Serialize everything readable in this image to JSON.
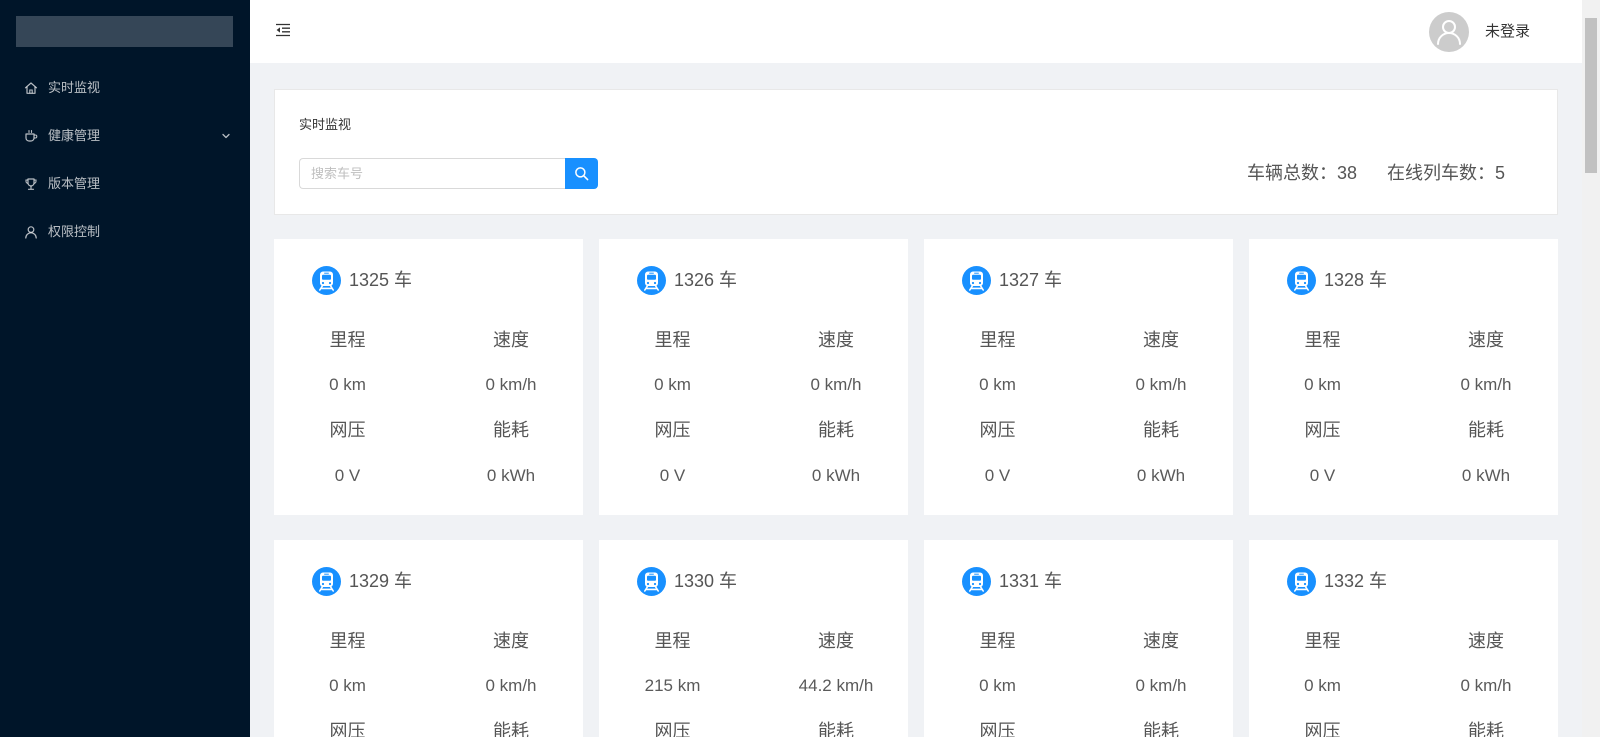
{
  "sidebar": {
    "menu": [
      {
        "label": "实时监视",
        "icon": "home-icon"
      },
      {
        "label": "健康管理",
        "icon": "coffee-icon",
        "has_submenu": true
      },
      {
        "label": "版本管理",
        "icon": "trophy-icon"
      },
      {
        "label": "权限控制",
        "icon": "user-icon"
      }
    ]
  },
  "header": {
    "fold_icon": "menu-fold-icon",
    "avatar_icon": "user-avatar-icon",
    "user_label": "未登录"
  },
  "main": {
    "panel_title": "实时监视",
    "search": {
      "placeholder": "搜索车号",
      "value": "",
      "button_icon": "search-icon"
    },
    "stats": {
      "total": {
        "label": "车辆总数：",
        "value": "38"
      },
      "online": {
        "label": "在线列车数：",
        "value": "5"
      }
    },
    "metric_labels": {
      "mileage": "里程",
      "speed": "速度",
      "voltage": "网压",
      "energy": "能耗"
    },
    "trains": [
      {
        "title": "1325 车",
        "mileage": "0 km",
        "speed": "0 km/h",
        "voltage": "0 V",
        "energy": "0 kWh"
      },
      {
        "title": "1326 车",
        "mileage": "0 km",
        "speed": "0 km/h",
        "voltage": "0 V",
        "energy": "0 kWh"
      },
      {
        "title": "1327 车",
        "mileage": "0 km",
        "speed": "0 km/h",
        "voltage": "0 V",
        "energy": "0 kWh"
      },
      {
        "title": "1328 车",
        "mileage": "0 km",
        "speed": "0 km/h",
        "voltage": "0 V",
        "energy": "0 kWh"
      },
      {
        "title": "1329 车",
        "mileage": "0 km",
        "speed": "0 km/h"
      },
      {
        "title": "1330 车",
        "mileage": "215 km",
        "speed": "44.2 km/h"
      },
      {
        "title": "1331 车",
        "mileage": "0 km",
        "speed": "0 km/h"
      },
      {
        "title": "1332 车",
        "mileage": "0 km",
        "speed": "0 km/h"
      }
    ]
  },
  "colors": {
    "sidebar_bg": "#001529",
    "accent": "#1890ff",
    "page_bg": "#f0f2f5",
    "card_bg": "#ffffff"
  }
}
